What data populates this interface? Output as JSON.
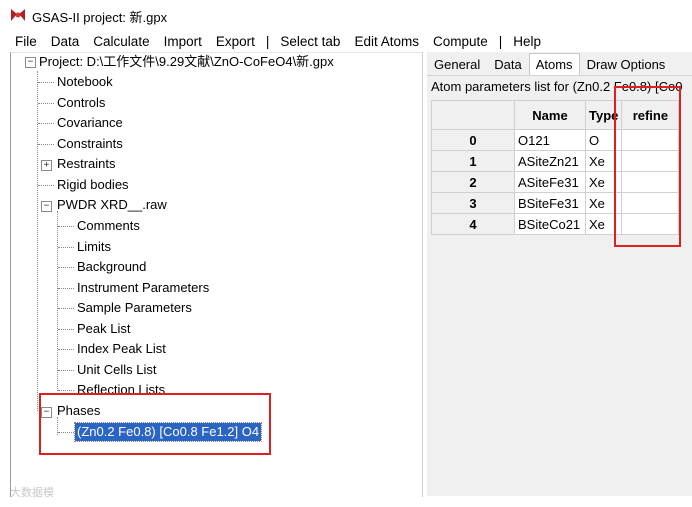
{
  "window": {
    "title": "GSAS-II project: 新.gpx"
  },
  "menu": [
    "File",
    "Data",
    "Calculate",
    "Import",
    "Export",
    "|",
    "Select tab",
    "Edit Atoms",
    "Compute",
    "|",
    "Help"
  ],
  "tree": {
    "root": "Project: D:\\工作文件\\9.29文献\\ZnO-CoFeO4\\新.gpx",
    "items": {
      "notebook": "Notebook",
      "controls": "Controls",
      "covariance": "Covariance",
      "constraints": "Constraints",
      "restraints": "Restraints",
      "rigid_bodies": "Rigid bodies",
      "pwdr": "PWDR XRD__.raw",
      "phases": "Phases"
    },
    "pwdr_children": [
      "Comments",
      "Limits",
      "Background",
      "Instrument Parameters",
      "Sample Parameters",
      "Peak List",
      "Index Peak List",
      "Unit Cells List",
      "Reflection Lists"
    ],
    "phase_selected": "(Zn0.2 Fe0.8) [Co0.8 Fe1.2] O4",
    "expander_plus": "+",
    "expander_minus": "−"
  },
  "right_panel": {
    "tabs": [
      "General",
      "Data",
      "Atoms",
      "Draw Options"
    ],
    "active_tab": "Atoms",
    "title": "Atom parameters list for (Zn0.2 Fe0.8) [Co0",
    "columns": [
      "",
      "Name",
      "Type",
      "refine"
    ],
    "rows": [
      {
        "idx": "0",
        "name": "O121",
        "type": "O",
        "refine": ""
      },
      {
        "idx": "1",
        "name": "ASiteZn21",
        "type": "Xe",
        "refine": ""
      },
      {
        "idx": "2",
        "name": "ASiteFe31",
        "type": "Xe",
        "refine": ""
      },
      {
        "idx": "3",
        "name": "BSiteFe31",
        "type": "Xe",
        "refine": ""
      },
      {
        "idx": "4",
        "name": "BSiteCo21",
        "type": "Xe",
        "refine": ""
      }
    ]
  },
  "watermark": "大数据模",
  "colors": {
    "selection": "#2a64c5",
    "highlight_box": "#e02020"
  }
}
